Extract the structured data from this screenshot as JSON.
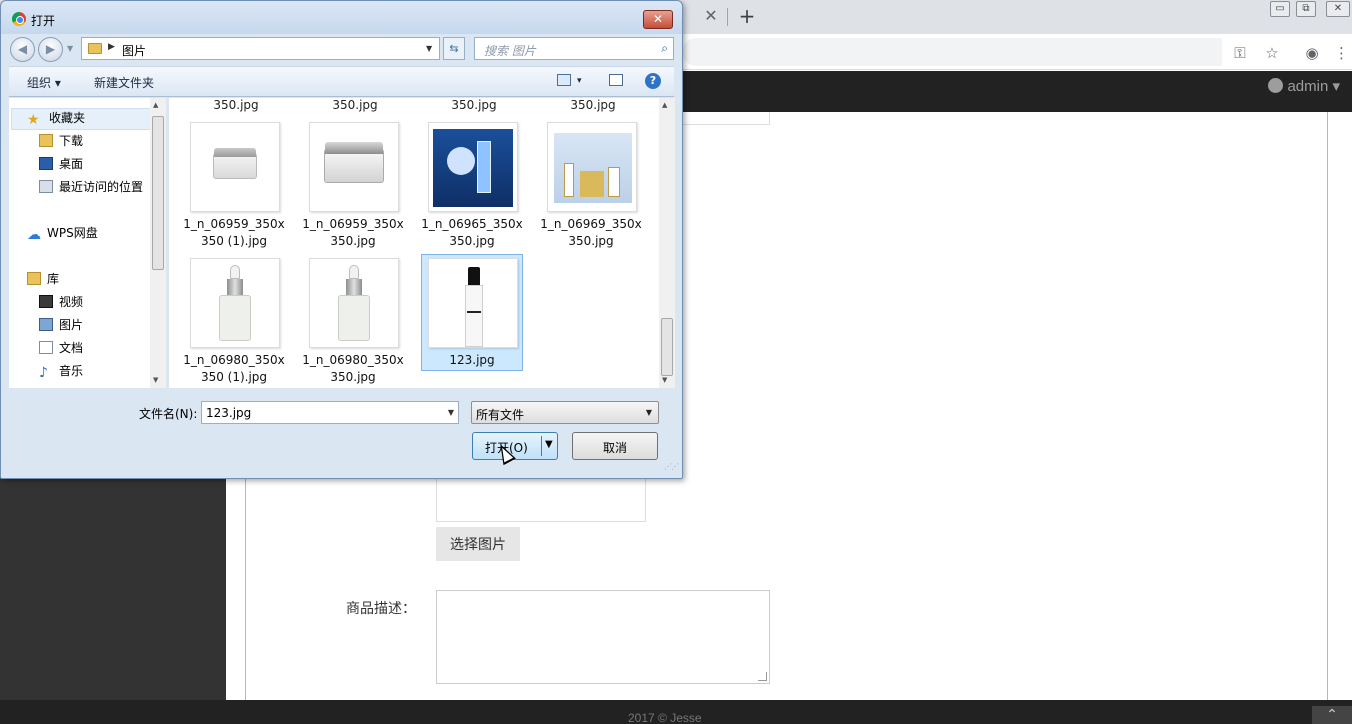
{
  "browser": {
    "tab_close_glyph": "✕",
    "newtab_glyph": "+",
    "window_controls": {
      "minimize": "▭",
      "restore": "⧉",
      "close": "✕"
    },
    "toolbar_icons": [
      "key-icon",
      "star-icon",
      "account-icon",
      "menu-icon"
    ]
  },
  "page": {
    "user": "admin",
    "user_caret": "▾",
    "choose_image_button": "选择图片",
    "description_label": "商品描述：",
    "footer": "2017 © Jesse",
    "scroll_top_glyph": "⌃"
  },
  "dialog": {
    "title": "打开",
    "close_glyph": "✕",
    "path": "图片",
    "search_placeholder": "搜索 图片",
    "toolbar": {
      "organize": "组织 ▾",
      "new_folder": "新建文件夹",
      "view_glyph": "▾",
      "help_glyph": "?"
    },
    "nav": {
      "favorites": "收藏夹",
      "downloads": "下载",
      "desktop": "桌面",
      "recent": "最近访问的位置",
      "wps": "WPS网盘",
      "libraries": "库",
      "videos": "视频",
      "pictures": "图片",
      "documents": "文档",
      "music": "音乐"
    },
    "files_top_row": [
      "350.jpg",
      "350.jpg",
      "350.jpg",
      "350.jpg"
    ],
    "files": [
      {
        "line1": "1_n_06959_350x",
        "line2": "350 (1).jpg",
        "art": "jar"
      },
      {
        "line1": "1_n_06959_350x",
        "line2": "350.jpg",
        "art": "jar2"
      },
      {
        "line1": "1_n_06965_350x",
        "line2": "350.jpg",
        "art": "giftblue"
      },
      {
        "line1": "1_n_06969_350x",
        "line2": "350.jpg",
        "art": "giftgold"
      },
      {
        "line1": "1_n_06980_350x",
        "line2": "350 (1).jpg",
        "art": "dropper"
      },
      {
        "line1": "1_n_06980_350x",
        "line2": "350.jpg",
        "art": "dropper"
      },
      {
        "line1": "123.jpg",
        "line2": "",
        "art": "spray",
        "selected": true
      }
    ],
    "filename_label": "文件名(N):",
    "filename_value": "123.jpg",
    "filter_value": "所有文件",
    "open_button": "打开(O)",
    "cancel_button": "取消"
  },
  "colors": {
    "navbar": "#222222",
    "selection": "#cce8ff",
    "accent_green_line": "#8fd19e"
  }
}
